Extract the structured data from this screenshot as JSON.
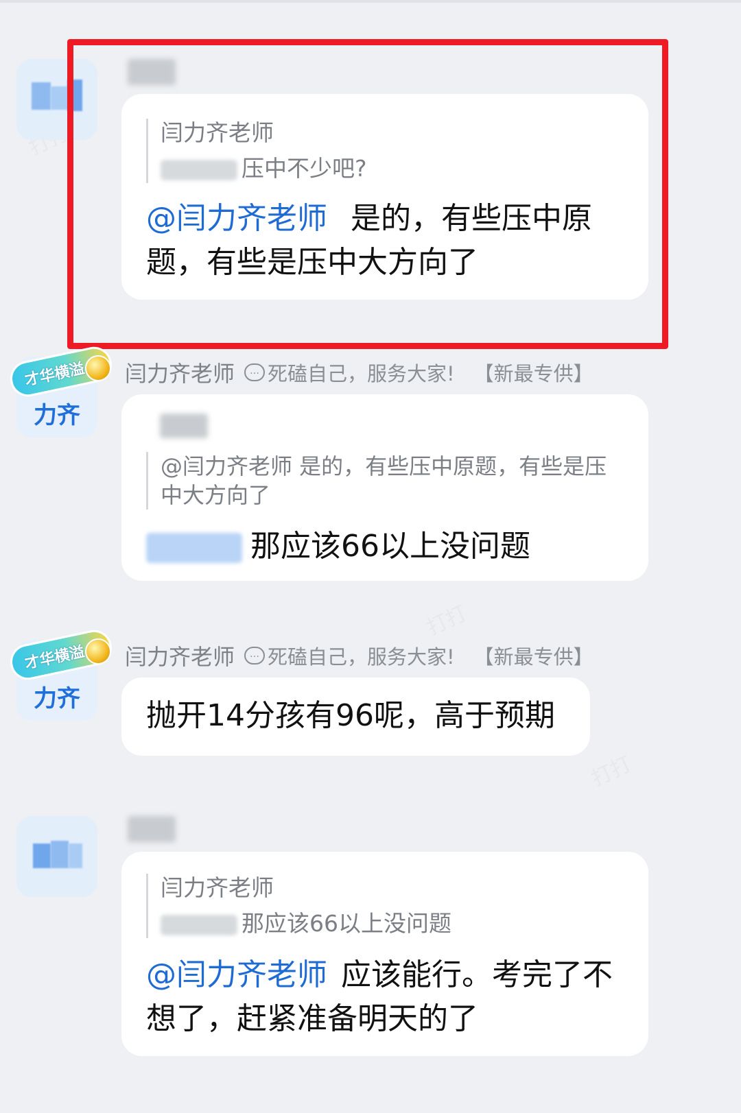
{
  "colors": {
    "background": "#eef0f3",
    "bubble": "#ffffff",
    "mention": "#1f6bd4",
    "highlight_frame": "#ee1b24",
    "avatar_text": "#1e6fd9"
  },
  "icons": {
    "signature": "speech-bubble-icon"
  },
  "teacher": {
    "badge_text": "才华横溢",
    "avatar_text": "力齐",
    "name": "闫力齐老师",
    "signature_icon_glyph": "…",
    "signature": "死磕自己，服务大家!",
    "tag": "【新最专供】"
  },
  "messages": [
    {
      "quote_author": "闫力齐老师",
      "quote_text": "压中不少吧?",
      "mention": "@闫力齐老师",
      "text": "是的，有些压中原题，有些是压中大方向了"
    },
    {
      "quote_text": "@闫力齐老师   是的，有些压中原题，有些是压中大方向了",
      "text": "那应该66以上没问题"
    },
    {
      "text": "抛开14分孩有96呢，高于预期"
    },
    {
      "quote_author": "闫力齐老师",
      "quote_text": "那应该66以上没问题",
      "mention": "@闫力齐老师",
      "text": "应该能行。考完了不想了，赶紧准备明天的了"
    }
  ]
}
